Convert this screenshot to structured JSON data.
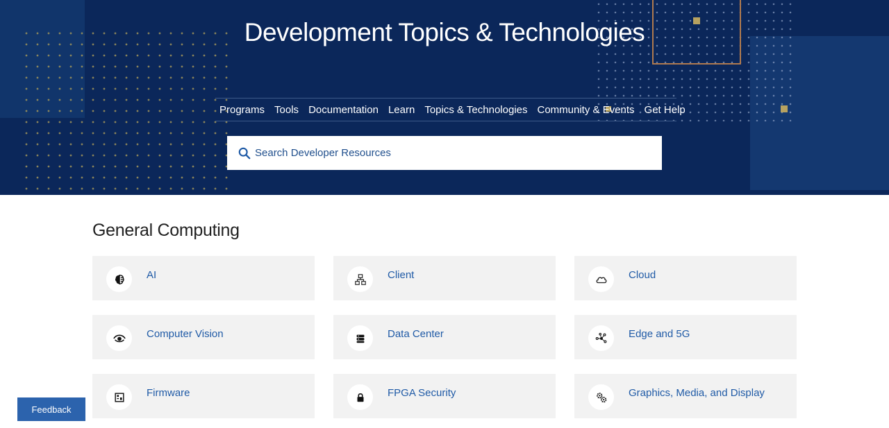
{
  "hero": {
    "title": "Development Topics & Technologies",
    "nav": [
      "Programs",
      "Tools",
      "Documentation",
      "Learn",
      "Topics & Technologies",
      "Community & Events",
      "Get Help"
    ],
    "search": {
      "placeholder": "Search Developer Resources",
      "icon": "search-icon"
    }
  },
  "section": {
    "title": "General Computing",
    "cards": [
      {
        "label": "AI",
        "icon": "brain-icon"
      },
      {
        "label": "Client",
        "icon": "network-hierarchy-icon"
      },
      {
        "label": "Cloud",
        "icon": "cloud-icon"
      },
      {
        "label": "Computer Vision",
        "icon": "eye-icon"
      },
      {
        "label": "Data Center",
        "icon": "server-icon"
      },
      {
        "label": "Edge and 5G",
        "icon": "nodes-icon"
      },
      {
        "label": "Firmware",
        "icon": "chip-icon"
      },
      {
        "label": "FPGA Security",
        "icon": "lock-icon"
      },
      {
        "label": "Graphics, Media, and Display",
        "icon": "gears-icon"
      }
    ]
  },
  "feedback": {
    "label": "Feedback"
  },
  "colors": {
    "hero_bg": "#0b275a",
    "link": "#1f5aa6",
    "card_bg": "#f2f2f2",
    "feedback_bg": "#2c63ad"
  }
}
